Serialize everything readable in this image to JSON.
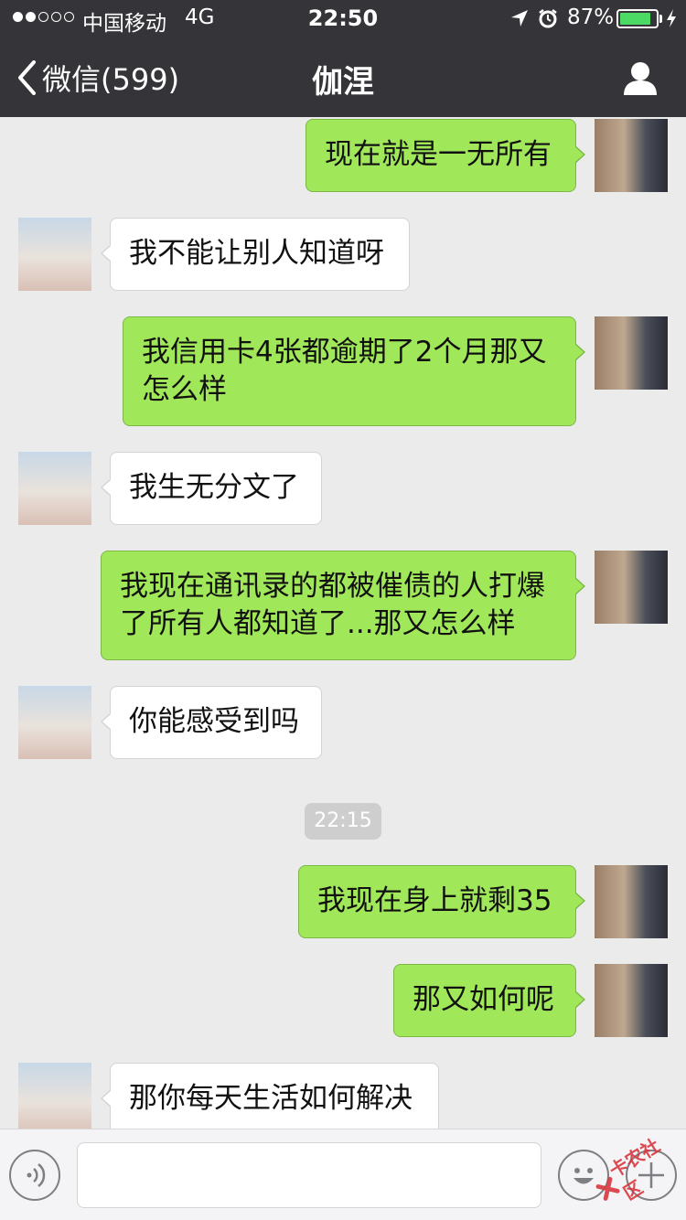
{
  "status_bar": {
    "signal_bars": 2,
    "carrier": "中国移动",
    "network": "4G",
    "time": "22:50",
    "battery_percent": "87%",
    "battery_level": 0.87
  },
  "nav": {
    "back_label": "微信(599)",
    "title": "伽涅",
    "profile_icon": "person-icon"
  },
  "messages": [
    {
      "side": "out",
      "text": "现在就是一无所有"
    },
    {
      "side": "in",
      "text": "我不能让别人知道呀"
    },
    {
      "side": "out",
      "line1": "我信用卡4张都逾期了2个月那又",
      "line2": "怎么样"
    },
    {
      "side": "in",
      "text": "我生无分文了"
    },
    {
      "side": "out",
      "line1": "我现在通讯录的都被催债的人打爆",
      "line2": "了所有人都知道了...那又怎么样"
    },
    {
      "side": "in",
      "text": "你能感受到吗"
    },
    {
      "side": "out",
      "text": "我现在身上就剩35"
    },
    {
      "side": "out",
      "text": "那又如何呢"
    },
    {
      "side": "in",
      "text": "那你每天生活如何解决"
    }
  ],
  "timestamp": "22:15",
  "input_bar": {
    "voice_icon": "voice-icon",
    "emoji_icon": "emoji-icon",
    "plus_icon": "plus-icon",
    "text_value": ""
  },
  "watermark": {
    "text": "卡农社区"
  },
  "colors": {
    "header_bg": "#353539",
    "chat_bg": "#ebebeb",
    "outgoing_bubble": "#a0e75a",
    "incoming_bubble": "#ffffff",
    "battery_green": "#4cd964"
  }
}
